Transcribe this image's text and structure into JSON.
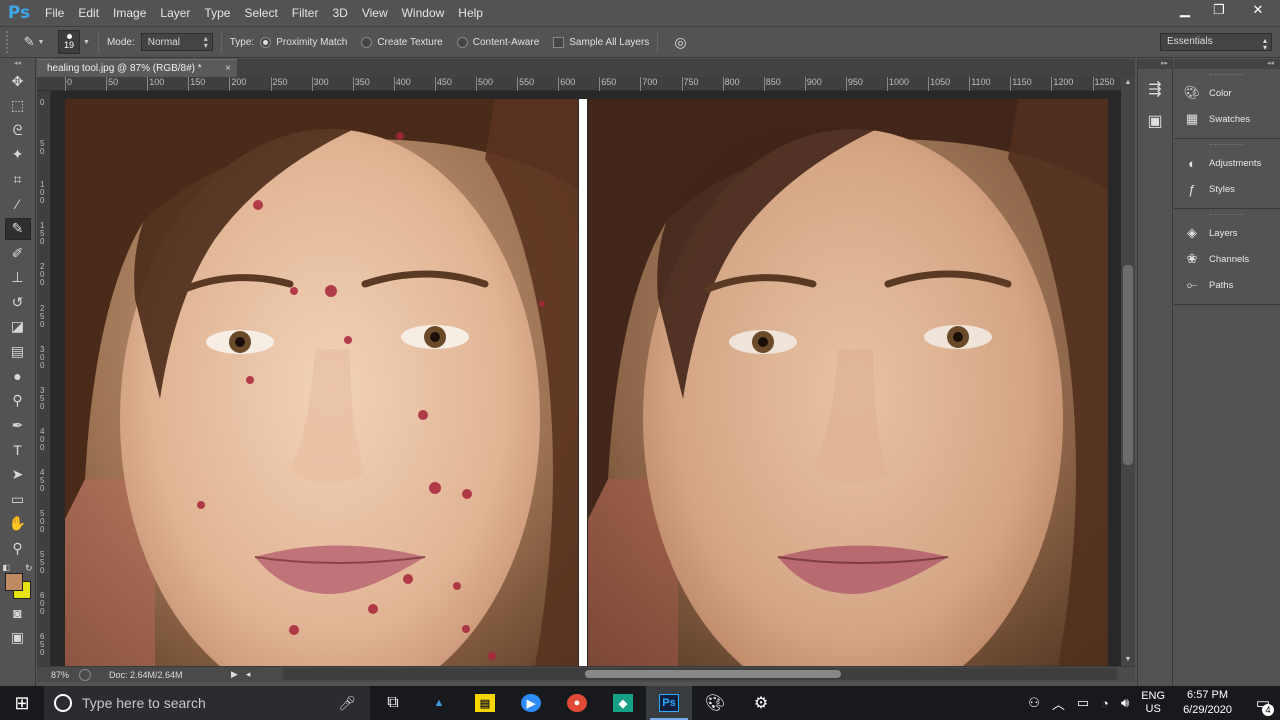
{
  "menubar": {
    "logo": "Ps",
    "items": [
      "File",
      "Edit",
      "Image",
      "Layer",
      "Type",
      "Select",
      "Filter",
      "3D",
      "View",
      "Window",
      "Help"
    ]
  },
  "options": {
    "brush_size": "19",
    "mode_label": "Mode:",
    "mode_value": "Normal",
    "type_label": "Type:",
    "radio_proximity": "Proximity Match",
    "radio_texture": "Create Texture",
    "radio_content": "Content-Aware",
    "sample_all": "Sample All Layers",
    "workspace": "Essentials"
  },
  "document": {
    "tab_title": "healing tool.jpg @ 87% (RGB/8#) *",
    "tab_close": "×",
    "ruler_h": [
      "0",
      "50",
      "100",
      "150",
      "200",
      "250",
      "300",
      "350",
      "400",
      "450",
      "500",
      "550",
      "600",
      "650",
      "700",
      "750",
      "800",
      "850",
      "900",
      "950",
      "1000",
      "1050",
      "1100",
      "1150",
      "1200",
      "1250"
    ],
    "ruler_v": [
      "0",
      "50",
      "100",
      "150",
      "200",
      "250",
      "300",
      "350",
      "400",
      "450",
      "500",
      "550",
      "600",
      "650"
    ]
  },
  "status": {
    "zoom": "87%",
    "doc": "Doc: 2.64M/2.64M"
  },
  "panels": {
    "group1": [
      "Color",
      "Swatches"
    ],
    "group2": [
      "Adjustments",
      "Styles"
    ],
    "group3": [
      "Layers",
      "Channels",
      "Paths"
    ]
  },
  "taskbar": {
    "search_placeholder": "Type here to search",
    "lang_top": "ENG",
    "lang_bottom": "US",
    "time": "6:57 PM",
    "date": "6/29/2020",
    "notif_count": "4"
  }
}
